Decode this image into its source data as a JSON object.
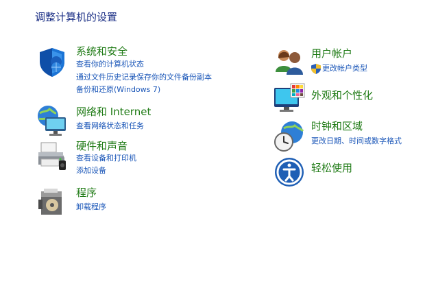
{
  "page": {
    "title": "调整计算机的设置"
  },
  "left": {
    "system_security": {
      "title": "系统和安全",
      "links": [
        "查看你的计算机状态",
        "通过文件历史记录保存你的文件备份副本",
        "备份和还原(Windows 7)"
      ],
      "icon": "shield-icon"
    },
    "network": {
      "title": "网络和 Internet",
      "links": [
        "查看网络状态和任务"
      ],
      "icon": "network-globe-icon"
    },
    "hardware": {
      "title": "硬件和声音",
      "links": [
        "查看设备和打印机",
        "添加设备"
      ],
      "icon": "printer-icon"
    },
    "programs": {
      "title": "程序",
      "links": [
        "卸载程序"
      ],
      "icon": "programs-box-icon"
    }
  },
  "right": {
    "accounts": {
      "title": "用户帐户",
      "links": [
        "更改帐户类型"
      ],
      "icon": "users-icon"
    },
    "appearance": {
      "title": "外观和个性化",
      "links": [],
      "icon": "monitor-palette-icon"
    },
    "clock": {
      "title": "时钟和区域",
      "links": [
        "更改日期、时间或数字格式"
      ],
      "icon": "clock-globe-icon"
    },
    "ease": {
      "title": "轻松使用",
      "links": [],
      "icon": "ease-of-access-icon"
    }
  },
  "colors": {
    "title_blue": "#1e3287",
    "category_green": "#1e7a14",
    "link_blue": "#1a56b8"
  }
}
